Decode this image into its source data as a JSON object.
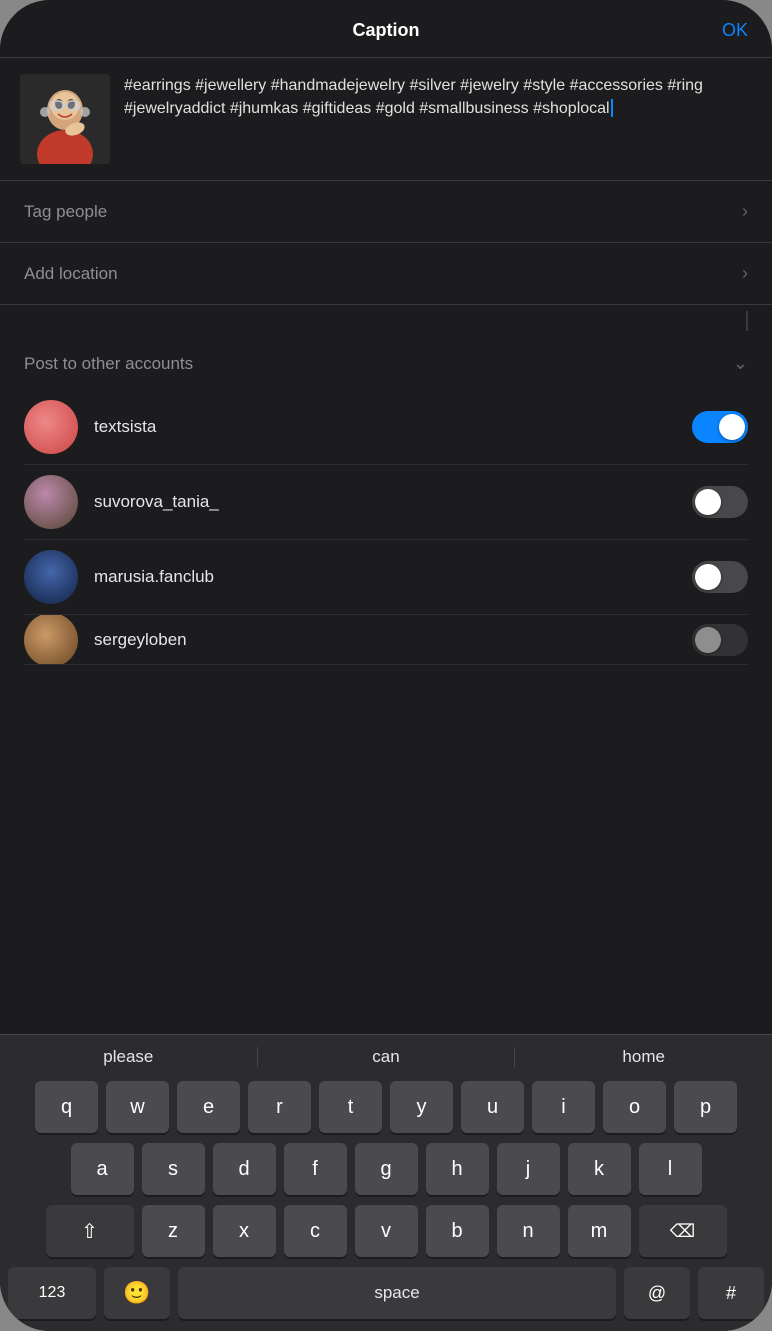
{
  "header": {
    "title": "Caption",
    "ok_label": "OK"
  },
  "caption": {
    "text": "#earrings #jewellery #handmadejewelry #silver #jewelry #style #accessories #ring #jewelryaddict #jhumkas #giftideas #gold #smallbusiness #shoplocal"
  },
  "menu": {
    "tag_people": "Tag people",
    "add_location": "Add location"
  },
  "post_to": {
    "label": "Post to other accounts",
    "accounts": [
      {
        "name": "textsista",
        "enabled": true
      },
      {
        "name": "suvorova_tania_",
        "enabled": false
      },
      {
        "name": "marusia.fanclub",
        "enabled": false
      },
      {
        "name": "sergeyloben",
        "enabled": false
      }
    ]
  },
  "predictive": {
    "words": [
      "please",
      "can",
      "home"
    ]
  },
  "keyboard": {
    "rows": [
      [
        "q",
        "w",
        "e",
        "r",
        "t",
        "y",
        "u",
        "i",
        "o",
        "p"
      ],
      [
        "a",
        "s",
        "d",
        "f",
        "g",
        "h",
        "j",
        "k",
        "l"
      ],
      [
        "z",
        "x",
        "c",
        "v",
        "b",
        "n",
        "m"
      ]
    ],
    "space_label": "space",
    "num_label": "123",
    "at_label": "@",
    "hash_label": "#"
  }
}
